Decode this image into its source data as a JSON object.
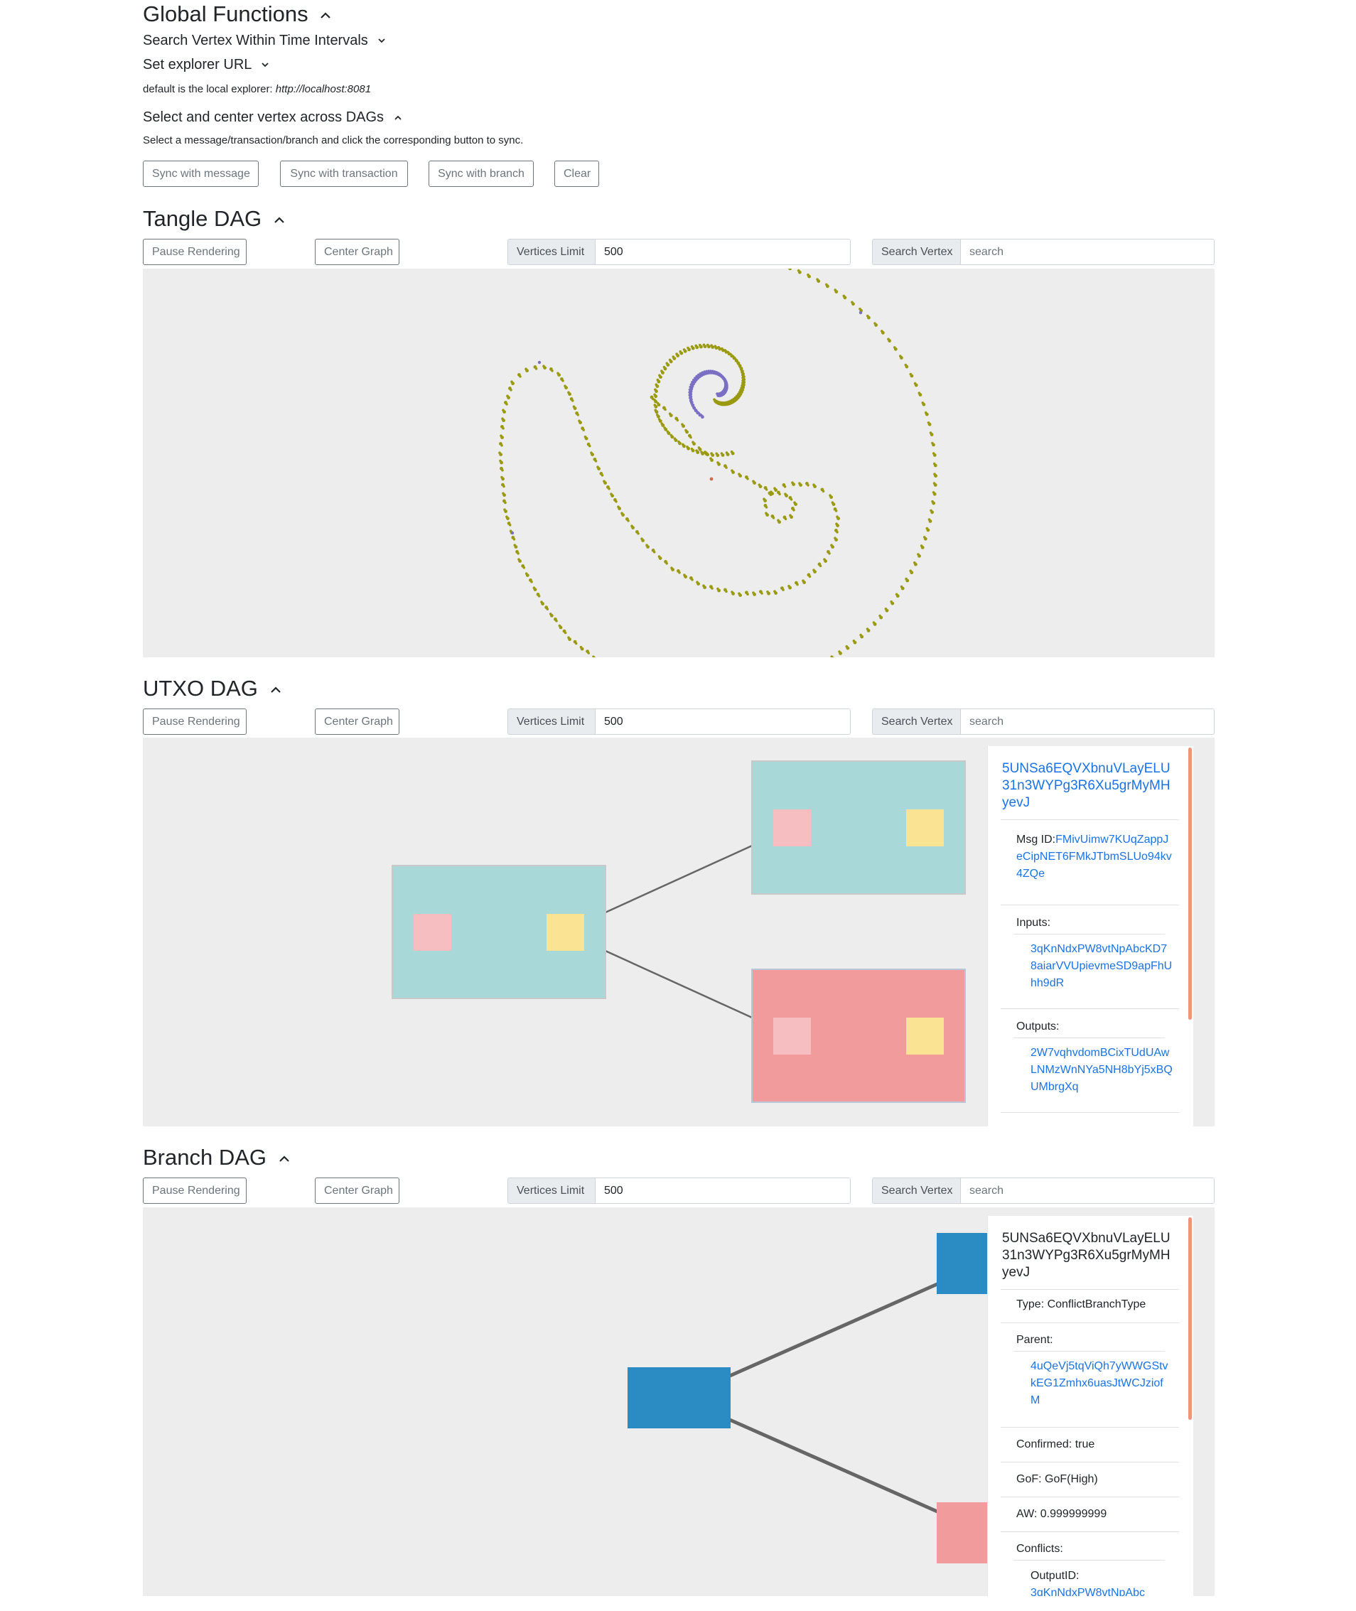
{
  "global": {
    "title": "Global Functions",
    "search_interval": "Search Vertex Within Time Intervals",
    "explorer_url": "Set explorer URL",
    "explorer_note_prefix": "default is the local explorer: ",
    "explorer_note_url": "http://localhost:8081",
    "sync_title": "Select and center vertex across DAGs",
    "sync_note": "Select a message/transaction/branch and click the corresponding button to sync.",
    "buttons": {
      "sync_message": "Sync with message",
      "sync_transaction": "Sync with transaction",
      "sync_branch": "Sync with branch",
      "clear": "Clear"
    }
  },
  "controls": {
    "pause": "Pause Rendering",
    "center": "Center Graph",
    "vertices_limit_label": "Vertices Limit",
    "vertices_limit_value": "500",
    "search_label": "Search Vertex",
    "search_placeholder": "search"
  },
  "tangle": {
    "title": "Tangle DAG"
  },
  "utxo": {
    "title": "UTXO DAG",
    "panel": {
      "id": "5UNSa6EQVXbnuVLayELU31n3WYPg3R6Xu5grMyMHyevJ",
      "msg_label": "Msg ID:",
      "msg_id": "FMivUimw7KUqZappJeCipNET6FMkJTbmSLUo94kv4ZQe",
      "inputs_label": "Inputs:",
      "inputs": [
        "3qKnNdxPW8vtNpAbcKD78aiarVVUpievmeSD9apFhUhh9dR"
      ],
      "outputs_label": "Outputs:",
      "outputs": [
        "2W7vqhvdomBCixTUdUAwLNMzWnNYa5NH8bYj5xBQUMbrgXq"
      ]
    },
    "colors": {
      "tx": "#a8d9d8",
      "tx_conflict": "#f29b9d",
      "input": "#f7bec2",
      "output": "#fbe394"
    }
  },
  "branch": {
    "title": "Branch DAG",
    "panel": {
      "id": "5UNSa6EQVXbnuVLayELU31n3WYPg3R6Xu5grMyMHyevJ",
      "type": "Type: ConflictBranchType",
      "parent_label": "Parent:",
      "parents": [
        "4uQeVj5tqViQh7yWWGStvkEG1Zmhx6uasJtWCJziofM"
      ],
      "confirmed": "Confirmed: true",
      "gof": "GoF: GoF(High)",
      "aw": "AW: 0.999999999",
      "conflicts_label": "Conflicts:",
      "output_id_label": "OutputID:",
      "output_id": "3qKnNdxPW8vtNpAbc"
    },
    "colors": {
      "branch": "#2b8bc3",
      "conflict": "#f29b9d"
    }
  }
}
